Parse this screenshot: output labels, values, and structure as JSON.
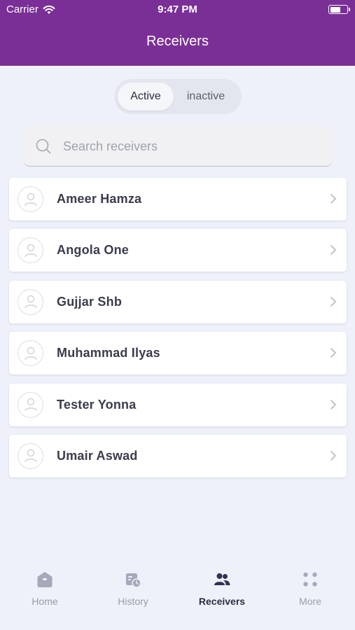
{
  "status_bar": {
    "carrier": "Carrier",
    "time": "9:47 PM"
  },
  "header": {
    "title": "Receivers",
    "background_color": "#7a2f96"
  },
  "segment": {
    "active_label": "Active",
    "inactive_label": "inactive",
    "selected": "Active"
  },
  "search": {
    "placeholder": "Search receivers",
    "value": ""
  },
  "receivers": [
    "Ameer Hamza",
    "Angola One",
    "Gujjar Shb",
    "Muhammad Ilyas",
    "Tester Yonna",
    "Umair Aswad"
  ],
  "tabbar": {
    "tabs": [
      {
        "label": "Home",
        "icon": "home-icon"
      },
      {
        "label": "History",
        "icon": "history-icon"
      },
      {
        "label": "Receivers",
        "icon": "receivers-icon"
      },
      {
        "label": "More",
        "icon": "more-icon"
      }
    ],
    "selected": "Receivers"
  }
}
